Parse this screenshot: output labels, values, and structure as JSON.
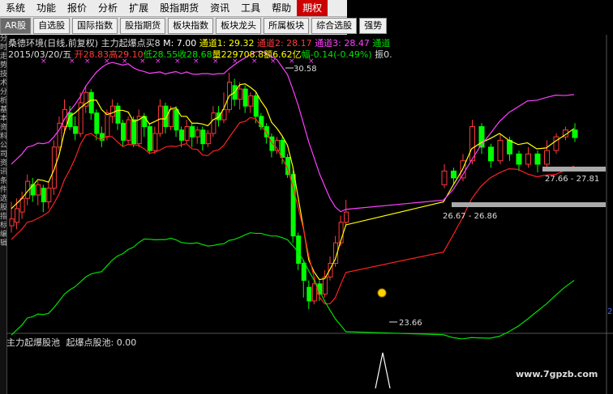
{
  "menu": [
    "系统",
    "功能",
    "报价",
    "分析",
    "扩展",
    "股指期货",
    "资讯",
    "工具",
    "帮助",
    "期权"
  ],
  "toolbar": [
    "AR股",
    "自选股",
    "国际指数",
    "股指期货",
    "板块指数",
    "板块龙头",
    "所属板块",
    "综合选股",
    "强势"
  ],
  "left_strip": [
    "分",
    "时",
    "走",
    "势",
    "技",
    "术",
    "分",
    "析",
    "基",
    "本",
    "资",
    "料",
    "公",
    "司",
    "资",
    "讯",
    "条",
    "件",
    "选",
    "股",
    "指",
    "标",
    "编",
    "辑"
  ],
  "stock": {
    "name": "桑德环境(日线,前复权)",
    "indicator": "主力起爆点买8",
    "m": "M: 7.00",
    "ch1": "通道1: 29.32",
    "ch2": "通道2: 28.17",
    "ch3": "通道3: 28.47",
    "ch4": "通道",
    "date": "2015/03/20/五",
    "open": "开28.83",
    "high": "高29.10",
    "low": "低28.55",
    "close": "收28.68",
    "vol": "量229708.8",
    "amount": "额6.62亿",
    "change": "幅-0.14(-0.49%)",
    "amp": "振0."
  },
  "price_labels": [
    "30.58",
    "26.67 - 26.86",
    "27.66 - 27.81",
    "23.66"
  ],
  "sub_panel": {
    "title": "主力起爆股池",
    "value": "起爆点股池: 0.00"
  },
  "right_label": "2",
  "watermark": "www.7gpzb.com",
  "colors": {
    "up": "#ff3a3a",
    "down": "#00ff00",
    "yellow": "#ffff00",
    "magenta": "#ff40ff",
    "green_line": "#00e000"
  },
  "candles": [
    [
      26.1,
      26.3,
      26.8,
      25.9
    ],
    [
      26.2,
      26.6,
      26.9,
      26.0
    ],
    [
      26.5,
      26.9,
      27.1,
      26.3
    ],
    [
      26.9,
      27.4,
      27.6,
      26.7
    ],
    [
      27.3,
      27.0,
      27.5,
      26.8
    ],
    [
      27.0,
      27.3,
      27.4,
      26.7
    ],
    [
      27.2,
      26.8,
      27.3,
      26.5
    ],
    [
      26.8,
      27.2,
      27.4,
      26.6
    ],
    [
      27.2,
      28.4,
      28.6,
      27.0
    ],
    [
      28.4,
      29.1,
      29.3,
      28.3
    ],
    [
      29.0,
      29.5,
      29.8,
      28.8
    ],
    [
      29.4,
      29.0,
      29.6,
      28.9
    ],
    [
      29.0,
      28.8,
      29.3,
      28.6
    ],
    [
      28.8,
      29.7,
      30.0,
      28.7
    ],
    [
      29.6,
      30.0,
      30.2,
      29.4
    ],
    [
      30.0,
      29.4,
      30.1,
      29.2
    ],
    [
      29.4,
      28.8,
      29.5,
      28.6
    ],
    [
      28.8,
      28.6,
      29.0,
      28.4
    ],
    [
      28.7,
      29.4,
      29.5,
      28.6
    ],
    [
      29.3,
      29.6,
      29.8,
      29.1
    ],
    [
      29.6,
      29.1,
      29.7,
      28.9
    ],
    [
      29.1,
      28.6,
      29.2,
      28.4
    ],
    [
      28.6,
      29.2,
      29.3,
      28.5
    ],
    [
      29.2,
      28.5,
      29.3,
      28.4
    ],
    [
      28.5,
      29.3,
      29.5,
      28.4
    ],
    [
      29.3,
      29.0,
      29.4,
      28.7
    ],
    [
      29.0,
      28.3,
      29.1,
      28.2
    ],
    [
      28.3,
      28.8,
      29.0,
      28.2
    ],
    [
      28.8,
      29.6,
      29.8,
      28.7
    ],
    [
      29.6,
      29.0,
      29.7,
      28.8
    ],
    [
      29.0,
      29.5,
      29.6,
      28.9
    ],
    [
      29.5,
      28.9,
      29.6,
      28.7
    ],
    [
      28.9,
      28.6,
      29.0,
      28.4
    ],
    [
      28.6,
      29.0,
      29.2,
      28.5
    ],
    [
      29.0,
      28.7,
      29.1,
      28.4
    ],
    [
      28.7,
      28.9,
      29.0,
      28.5
    ],
    [
      28.9,
      28.5,
      29.0,
      28.3
    ],
    [
      28.5,
      28.8,
      28.9,
      28.4
    ],
    [
      28.8,
      29.4,
      29.6,
      28.7
    ],
    [
      29.4,
      29.2,
      29.6,
      29.0
    ],
    [
      29.2,
      29.5,
      30.0,
      29.1
    ],
    [
      29.5,
      30.3,
      30.58,
      29.4
    ],
    [
      30.2,
      29.8,
      30.4,
      29.6
    ],
    [
      29.8,
      30.1,
      30.3,
      29.5
    ],
    [
      30.1,
      29.6,
      30.2,
      29.4
    ],
    [
      29.6,
      29.9,
      30.0,
      29.4
    ],
    [
      29.9,
      29.3,
      30.0,
      29.1
    ],
    [
      29.3,
      29.0,
      29.4,
      28.9
    ],
    [
      29.0,
      28.7,
      29.1,
      28.5
    ],
    [
      28.7,
      28.3,
      28.8,
      28.1
    ],
    [
      28.3,
      28.6,
      28.7,
      28.2
    ],
    [
      28.6,
      28.1,
      28.7,
      27.9
    ],
    [
      28.1,
      27.6,
      28.2,
      27.5
    ],
    [
      27.6,
      25.8,
      27.7,
      25.6
    ],
    [
      25.8,
      25.0,
      25.9,
      24.8
    ],
    [
      25.0,
      24.5,
      25.1,
      24.0
    ],
    [
      24.3,
      23.9,
      24.5,
      23.66
    ],
    [
      23.9,
      24.4,
      24.6,
      23.8
    ],
    [
      24.4,
      24.1,
      24.5,
      23.9
    ],
    [
      24.1,
      24.6,
      24.8,
      24.0
    ],
    [
      24.6,
      25.0,
      25.2,
      24.5
    ],
    [
      25.0,
      25.6,
      25.8,
      24.9
    ],
    [
      25.6,
      26.2,
      26.4,
      25.5
    ],
    [
      26.2,
      26.5,
      26.86,
      26.1
    ]
  ],
  "candles2": [
    [
      27.3,
      27.7,
      27.9,
      27.2
    ],
    [
      27.7,
      27.5,
      27.8,
      27.3
    ],
    [
      27.5,
      28.0,
      28.2,
      27.4
    ],
    [
      28.0,
      29.0,
      29.2,
      27.9
    ],
    [
      29.0,
      28.4,
      29.1,
      28.2
    ],
    [
      28.4,
      28.0,
      28.5,
      27.8
    ],
    [
      28.0,
      28.6,
      28.8,
      27.9
    ],
    [
      28.6,
      28.2,
      28.7,
      28.0
    ],
    [
      28.2,
      27.9,
      28.3,
      27.7
    ],
    [
      27.9,
      28.2,
      28.4,
      27.8
    ],
    [
      28.2,
      27.9,
      28.3,
      27.66
    ],
    [
      27.9,
      28.3,
      28.6,
      27.81
    ],
    [
      28.3,
      28.7,
      28.8,
      28.2
    ],
    [
      28.7,
      28.9,
      29.0,
      28.6
    ],
    [
      28.9,
      28.68,
      29.1,
      28.55
    ]
  ]
}
